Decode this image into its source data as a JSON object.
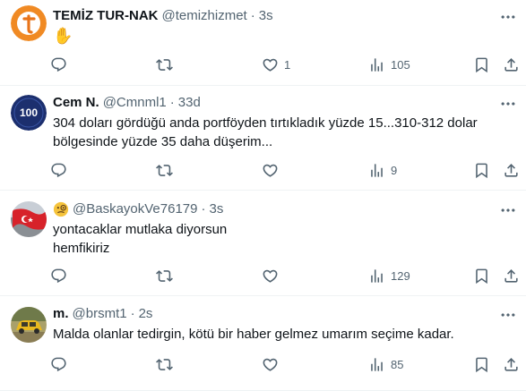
{
  "tweets": [
    {
      "name": "TEMİZ TUR-NAK",
      "handle": "@temizhizmet",
      "time": "3s",
      "text": "✋",
      "counts": {
        "reply": "",
        "retweet": "",
        "like": "1",
        "views": "105"
      },
      "avatar_icon": "orange-t-logo-avatar"
    },
    {
      "name": "Cem N.",
      "handle": "@Cmnml1",
      "time": "33d",
      "text": "304 doları gördüğü anda portföyden tırtıkladık yüzde 15...310-312 dolar bölgesinde yüzde 35 daha düşerim...",
      "counts": {
        "reply": "",
        "retweet": "",
        "like": "",
        "views": "9"
      },
      "avatar_icon": "navy-100-logo-avatar",
      "avatar_text": "100"
    },
    {
      "name": "",
      "handle": "@BaskayokVe76179",
      "time": "3s",
      "text": "yontacaklar mutlaka diyorsun\nhemfikiriz",
      "counts": {
        "reply": "",
        "retweet": "",
        "like": "",
        "views": "129"
      },
      "avatar_icon": "flag-photo-avatar",
      "name_icon": "monocle-face-emoji"
    },
    {
      "name": "m.",
      "handle": "@brsmt1",
      "time": "2s",
      "text": "Malda olanlar tedirgin, kötü bir haber gelmez umarım seçime kadar.",
      "counts": {
        "reply": "",
        "retweet": "",
        "like": "",
        "views": "85"
      },
      "avatar_icon": "yellow-car-photo-avatar"
    }
  ],
  "separator": "·",
  "colors": {
    "text": "#0f1419",
    "secondary": "#536471",
    "divider": "#eff3f4"
  }
}
